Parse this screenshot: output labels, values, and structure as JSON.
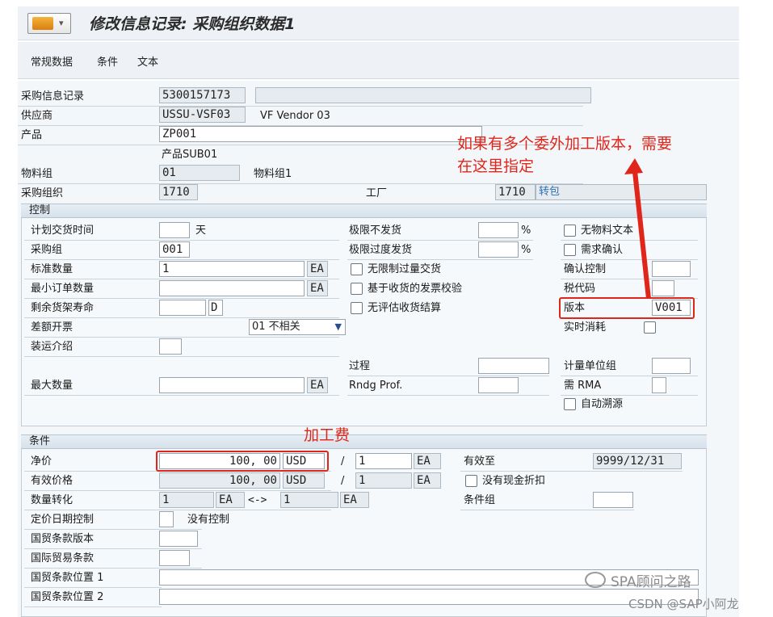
{
  "window": {
    "title": "修改信息记录: 采购组织数据1"
  },
  "menu": [
    "常规数据",
    "条件",
    "文本"
  ],
  "header": {
    "info_record_label": "采购信息记录",
    "info_record_value": "5300157173",
    "vendor_label": "供应商",
    "vendor_value": "USSU-VSF03",
    "vendor_name": "VF Vendor 03",
    "product_label": "产品",
    "product_value": "ZP001",
    "product_desc": "产品SUB01",
    "matgroup_label": "物料组",
    "matgroup_value": "01",
    "matgroup_desc": "物料组1",
    "purchorg_label": "采购组织",
    "purchorg_value": "1710",
    "plant_label": "工厂",
    "plant_value": "1710",
    "plant_desc": "转包"
  },
  "control": {
    "title": "控制",
    "planned_delivery_label": "计划交货时间",
    "planned_delivery_unit": "天",
    "purch_group_label": "采购组",
    "purch_group_value": "001",
    "std_qty_label": "标准数量",
    "std_qty_value": "1",
    "std_qty_unit": "EA",
    "min_order_label": "最小订单数量",
    "min_order_unit": "EA",
    "shelf_life_label": "剩余货架寿命",
    "shelf_life_unit": "D",
    "diff_invoice_label": "差额开票",
    "diff_invoice_value": "01 不相关",
    "shipping_label": "装运介绍",
    "max_qty_label": "最大数量",
    "max_qty_unit": "EA",
    "underdelivery_label": "极限不发货",
    "overdelivery_label": "极限过度发货",
    "percent": "%",
    "unlimited_label": "无限制过量交货",
    "gr_invoice_label": "基于收货的发票校验",
    "no_eval_label": "无评估收货结算",
    "process_label": "过程",
    "rndg_label": "Rndg Prof.",
    "no_mat_text_label": "无物料文本",
    "ack_req_label": "需求确认",
    "conf_ctrl_label": "确认控制",
    "tax_code_label": "税代码",
    "version_label": "版本",
    "version_value": "V001",
    "realtime_label": "实时消耗",
    "uom_group_label": "计量单位组",
    "rma_label": "需 RMA",
    "auto_source_label": "自动溯源"
  },
  "conditions": {
    "title": "条件",
    "net_price_label": "净价",
    "net_price_value": "100, 00",
    "currency": "USD",
    "per": "1",
    "unit": "EA",
    "eff_price_label": "有效价格",
    "eff_price_value": "100, 00",
    "qty_conv_label": "数量转化",
    "conv_left": "1",
    "conv_arrow": "<->",
    "conv_right": "1",
    "valid_to_label": "有效至",
    "valid_to_value": "9999/12/31",
    "no_cash_disc_label": "没有现金折扣",
    "cond_group_label": "条件组",
    "pricing_date_label": "定价日期控制",
    "pricing_date_desc": "没有控制",
    "incoterms_version_label": "国贸条款版本",
    "incoterms_label": "国际贸易条款",
    "incoterms_loc1_label": "国贸条款位置 1",
    "incoterms_loc2_label": "国贸条款位置 2"
  },
  "annotations": {
    "version_note_line1": "如果有多个委外加工版本，需要",
    "version_note_line2": "在这里指定",
    "fee_note": "加工费"
  },
  "watermark": {
    "line1": "SPA顾问之路",
    "line2": "CSDN @SAP小阿龙"
  },
  "colors": {
    "annotation_red": "#e0261b",
    "sap_bg": "#eef2f6",
    "section_header": "#dbe4ec"
  }
}
